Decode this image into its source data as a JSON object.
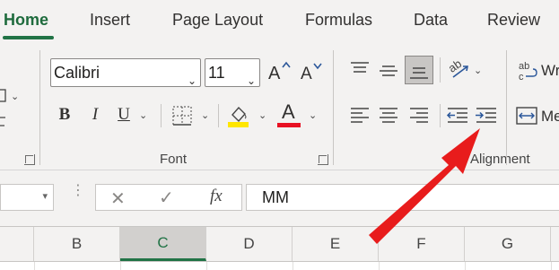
{
  "tabs": [
    {
      "label": "Home",
      "active": true
    },
    {
      "label": "Insert"
    },
    {
      "label": "Page Layout"
    },
    {
      "label": "Formulas"
    },
    {
      "label": "Data"
    },
    {
      "label": "Review"
    }
  ],
  "font_group": {
    "label": "Font",
    "font_name": "Calibri",
    "font_size": "11",
    "increase_size_icon": "increase-font-size",
    "decrease_size_icon": "decrease-font-size",
    "bold": "B",
    "italic": "I",
    "underline": "U",
    "font_color_glyph": "A",
    "highlight_color": "#ffe600",
    "font_color": "#e81123"
  },
  "alignment_group": {
    "label": "Alignment",
    "wrap_text_label": "Wr",
    "merge_label": "Me"
  },
  "formula_bar": {
    "cancel": "✕",
    "enter": "✓",
    "fx": "fx",
    "value": "MM"
  },
  "columns": [
    "B",
    "C",
    "D",
    "E",
    "F",
    "G"
  ],
  "selected_column": "C",
  "colors": {
    "accent": "#217346",
    "arrow": "#e81c1c"
  }
}
